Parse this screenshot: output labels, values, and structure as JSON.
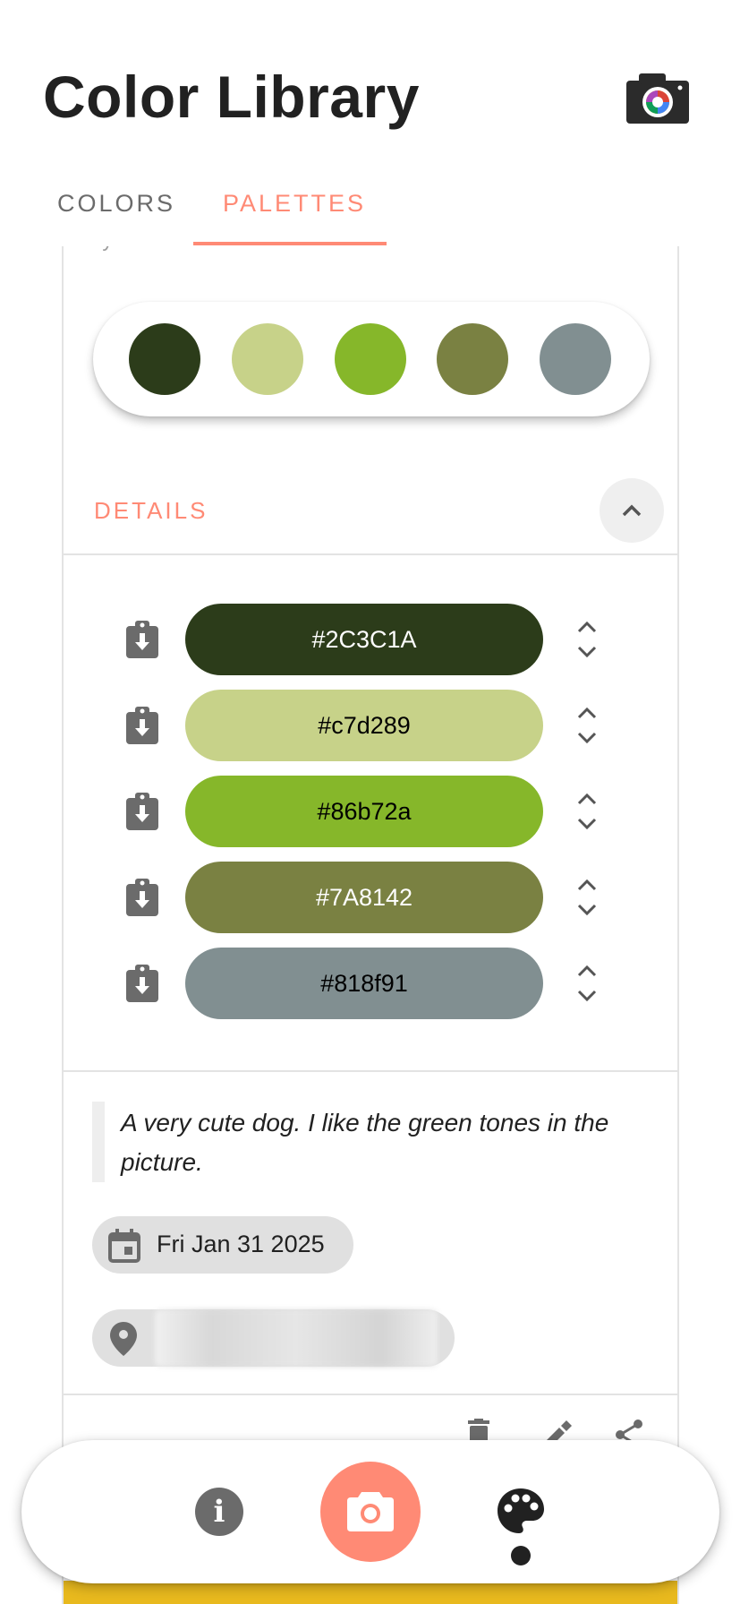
{
  "app": {
    "title": "Color Library",
    "header_icon": "camera-color-icon"
  },
  "tabs": [
    {
      "label": "COLORS",
      "active": false
    },
    {
      "label": "PALETTES",
      "active": true
    }
  ],
  "accent_color": "#ff8a75",
  "palette": {
    "byline": "by me",
    "swatches": [
      "#2C3C1A",
      "#c7d289",
      "#86b72a",
      "#7A8142",
      "#818f91"
    ],
    "details_label": "DETAILS",
    "details_expanded": true,
    "colors": [
      {
        "hex": "#2C3C1A",
        "bg": "#2C3C1A",
        "fg": "#ffffff"
      },
      {
        "hex": "#c7d289",
        "bg": "#c7d289",
        "fg": "#000000"
      },
      {
        "hex": "#86b72a",
        "bg": "#86b72a",
        "fg": "#000000"
      },
      {
        "hex": "#7A8142",
        "bg": "#7A8142",
        "fg": "#ffffff"
      },
      {
        "hex": "#818f91",
        "bg": "#818f91",
        "fg": "#000000"
      }
    ],
    "description": "A very cute dog. I like the green tones in the picture.",
    "date": "Fri Jan 31 2025",
    "location": "",
    "actions": [
      "delete-icon",
      "edit-icon",
      "share-icon"
    ]
  },
  "bottom_nav": {
    "items": [
      "info-icon",
      "camera-icon",
      "palette-icon"
    ],
    "active": "palette-icon"
  }
}
